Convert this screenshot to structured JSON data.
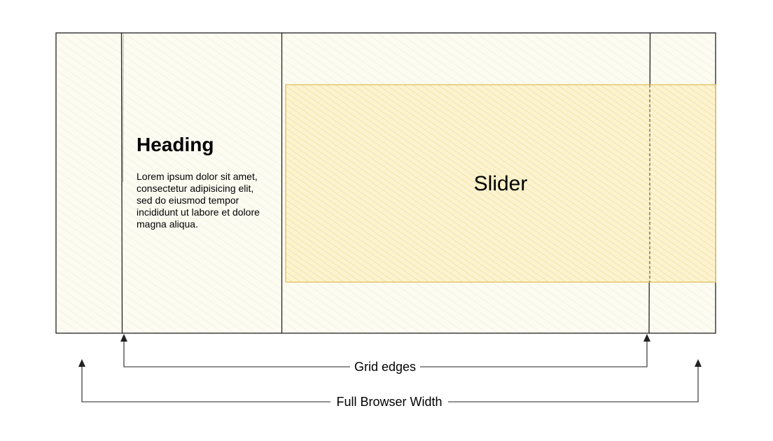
{
  "diagram": {
    "heading": "Heading",
    "body_lines": [
      "Lorem ipsum dolor sit amet,",
      "consectetur adipisicing elit,",
      "sed do eiusmod tempor",
      "incididunt ut labore et dolore",
      "magna aliqua."
    ],
    "slider_label": "Slider",
    "grid_edges_label": "Grid edges",
    "full_width_label": "Full Browser Width"
  },
  "colors": {
    "canvas_fill": "#fdfcf3",
    "canvas_hatch": "#efebd2",
    "slider_fill": "#fbf1c9",
    "slider_hatch": "#f3dc8a",
    "slider_border": "#e3c567",
    "line": "#222222"
  }
}
